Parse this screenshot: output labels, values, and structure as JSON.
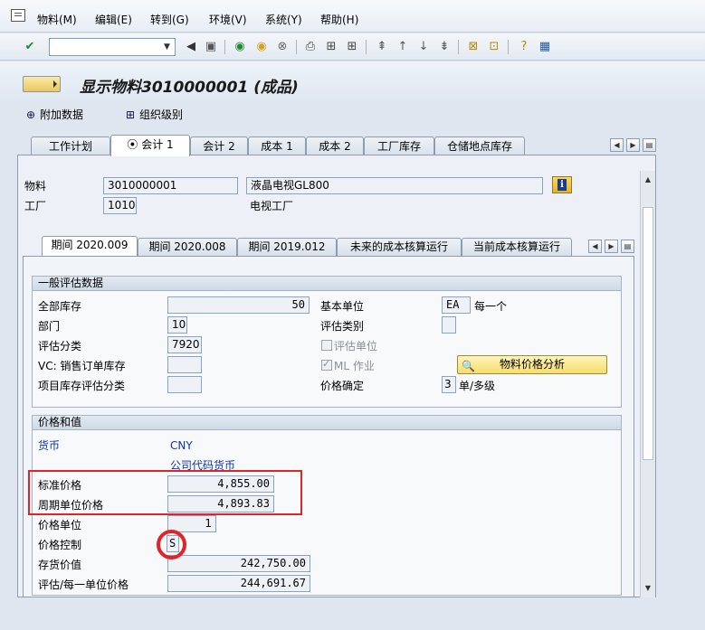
{
  "menu": [
    "物料(M)",
    "编辑(E)",
    "转到(G)",
    "环境(V)",
    "系统(Y)",
    "帮助(H)"
  ],
  "command_field": {
    "value": ""
  },
  "title": "显示物料3010000001 (成品)",
  "app_toolbar": {
    "additional_data": "附加数据",
    "org_levels": "组织级别"
  },
  "tabs": [
    "工作计划",
    "会计 1",
    "会计 2",
    "成本 1",
    "成本 2",
    "工厂库存",
    "仓储地点库存"
  ],
  "active_tab": "会计 1",
  "header": {
    "material_label": "物料",
    "material_value": "3010000001",
    "material_desc": "液晶电视GL800",
    "plant_label": "工厂",
    "plant_value": "1010",
    "plant_desc": "电视工厂"
  },
  "period_tabs": [
    "期间 2020.009",
    "期间 2020.008",
    "期间 2019.012",
    "未来的成本核算运行",
    "当前成本核算运行"
  ],
  "general_valuation": {
    "title": "一般评估数据",
    "total_stock_label": "全部库存",
    "total_stock_value": "50",
    "base_unit_label": "基本单位",
    "base_unit_value": "EA",
    "base_unit_desc": "每一个",
    "division_label": "部门",
    "division_value": "10",
    "valuation_category_label": "评估类别",
    "valuation_category_value": "",
    "valuation_class_label": "评估分类",
    "valuation_class_value": "7920",
    "valuated_unit_label": "评估单位",
    "vc_label": "VC: 销售订单库存",
    "vc_value": "",
    "ml_label": "ML 作业",
    "price_analysis_button": "物料价格分析",
    "project_stock_label": "项目库存评估分类",
    "project_stock_value": "",
    "price_determination_label": "价格确定",
    "price_determination_value": "3",
    "price_determination_desc": "单/多级"
  },
  "prices": {
    "title": "价格和值",
    "currency_label": "货币",
    "currency_value": "CNY",
    "company_code_currency": "公司代码货币",
    "standard_price_label": "标准价格",
    "standard_price_value": "4,855.00",
    "periodic_unit_price_label": "周期单位价格",
    "periodic_unit_price_value": "4,893.83",
    "price_unit_label": "价格单位",
    "price_unit_value": "1",
    "price_control_label": "价格控制",
    "price_control_value": "S",
    "stock_value_label": "存货价值",
    "stock_value_value": "242,750.00",
    "valuated_unit_price_label": "评估/每一单位价格",
    "valuated_unit_price_value": "244,691.67"
  }
}
